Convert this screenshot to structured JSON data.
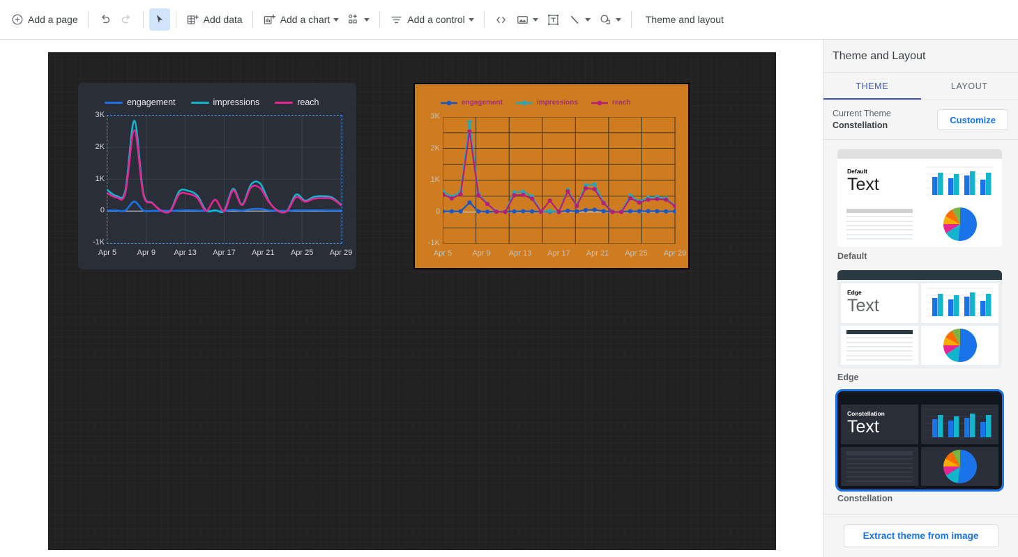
{
  "toolbar": {
    "add_page": "Add a page",
    "undo_icon": "undo-icon",
    "redo_icon": "redo-icon",
    "select_tool_icon": "cursor-arrow-icon",
    "add_data": "Add data",
    "add_chart": "Add a chart",
    "add_community_viz_icon": "community-visualization-icon",
    "add_control": "Add a control",
    "embed_icon": "embed-code-icon",
    "image_icon": "image-icon",
    "text_icon": "text-box-icon",
    "line_icon": "line-icon",
    "shape_icon": "shape-icon",
    "theme_and_layout": "Theme and layout"
  },
  "panel": {
    "title": "Theme and Layout",
    "tabs": [
      {
        "label": "THEME",
        "active": true
      },
      {
        "label": "LAYOUT",
        "active": false
      }
    ],
    "current_theme_label": "Current Theme",
    "current_theme_name": "Constellation",
    "customize_button": "Customize",
    "extract_theme_button": "Extract theme from image",
    "accent_color": "#1a73e8",
    "tab_active_color": "#4054b2",
    "themes": [
      {
        "name": "Default",
        "card_title": "Default",
        "card_text": "Text",
        "selected": false,
        "topbar": "#e0e0e0",
        "background": "#ffffff",
        "panel_bg": "#ffffff",
        "title_color": "#000000",
        "text_color": "#202124",
        "line_color": "#e8eaed",
        "line_head_color": "#d0d0d0"
      },
      {
        "name": "Edge",
        "card_title": "Edge",
        "card_text": "Text",
        "selected": false,
        "topbar": "#2b3a42",
        "background": "#eceff1",
        "panel_bg": "#ffffff",
        "title_color": "#000000",
        "text_color": "#5f6368",
        "line_color": "#e8eaed",
        "line_head_color": "#2b3a42"
      },
      {
        "name": "Constellation",
        "card_title": "Constellation",
        "card_text": "Text",
        "selected": true,
        "topbar": "#11161d",
        "background": "#11161d",
        "panel_bg": "#2a2e39",
        "title_color": "#ffffff",
        "text_color": "#ffffff",
        "line_color": "#343a46",
        "line_head_color": "#343a46"
      }
    ],
    "thumb_bar_colors": [
      "#1a73e8",
      "#12b5cb"
    ],
    "thumb_pie_colors": [
      "#1a73e8",
      "#12b5cb",
      "#e52592",
      "#f9ab00",
      "#ff6d01",
      "#7cb342"
    ]
  },
  "chart_data": [
    {
      "id": "chart1",
      "theme": "Constellation",
      "type": "line",
      "title": "",
      "xlabel": "",
      "ylabel": "",
      "smooth": true,
      "show_points": false,
      "selected": true,
      "background": "#2a2e39",
      "grid": true,
      "grid_color": "#3b4049",
      "legend_position": "top",
      "legend": [
        "engagement",
        "impressions",
        "reach"
      ],
      "ylim": [
        -1000,
        3000
      ],
      "yticks": [
        3000,
        2000,
        1000,
        0,
        -1000
      ],
      "ytick_labels": [
        "3K",
        "2K",
        "1K",
        "0",
        "-1K"
      ],
      "xticks": [
        "Apr 5",
        "Apr 9",
        "Apr 13",
        "Apr 17",
        "Apr 21",
        "Apr 25",
        "Apr 29"
      ],
      "x": [
        "Apr 4",
        "Apr 5",
        "Apr 6",
        "Apr 7",
        "Apr 8",
        "Apr 9",
        "Apr 10",
        "Apr 11",
        "Apr 12",
        "Apr 13",
        "Apr 14",
        "Apr 15",
        "Apr 16",
        "Apr 17",
        "Apr 18",
        "Apr 19",
        "Apr 20",
        "Apr 21",
        "Apr 22",
        "Apr 23",
        "Apr 24",
        "Apr 25",
        "Apr 26",
        "Apr 27",
        "Apr 28",
        "Apr 29",
        "Apr 30"
      ],
      "series": [
        {
          "name": "engagement",
          "color": "#1a73e8",
          "values": [
            20,
            20,
            20,
            300,
            20,
            10,
            10,
            10,
            20,
            25,
            20,
            10,
            10,
            10,
            40,
            20,
            60,
            70,
            25,
            10,
            10,
            25,
            25,
            30,
            25,
            20,
            20
          ]
        },
        {
          "name": "impressions",
          "color": "#12b5cb",
          "values": [
            660,
            480,
            640,
            2840,
            570,
            260,
            20,
            10,
            620,
            640,
            490,
            20,
            30,
            10,
            700,
            210,
            840,
            870,
            300,
            10,
            10,
            520,
            330,
            450,
            470,
            430,
            200
          ]
        },
        {
          "name": "reach",
          "color": "#e52592",
          "values": [
            560,
            430,
            560,
            2540,
            520,
            250,
            10,
            0,
            530,
            540,
            420,
            10,
            360,
            0,
            650,
            190,
            750,
            720,
            280,
            0,
            0,
            440,
            300,
            390,
            410,
            390,
            190
          ]
        }
      ]
    },
    {
      "id": "chart2",
      "theme": "Extracted (orange)",
      "type": "line",
      "title": "",
      "xlabel": "",
      "ylabel": "",
      "smooth": false,
      "show_points": true,
      "selected": false,
      "background": "#cf7c21",
      "grid": true,
      "grid_color": "#4a3a20",
      "legend_position": "top",
      "legend": [
        "engagement",
        "impressions",
        "reach"
      ],
      "legend_text_color": "#a0306e",
      "ylim": [
        -1000,
        3000
      ],
      "yticks": [
        3000,
        2000,
        1000,
        0,
        -1000
      ],
      "ytick_labels": [
        "3K",
        "2K",
        "1K",
        "0",
        "-1K"
      ],
      "xticks": [
        "Apr 5",
        "Apr 9",
        "Apr 13",
        "Apr 17",
        "Apr 21",
        "Apr 25",
        "Apr 29"
      ],
      "x": [
        "Apr 4",
        "Apr 5",
        "Apr 6",
        "Apr 7",
        "Apr 8",
        "Apr 9",
        "Apr 10",
        "Apr 11",
        "Apr 12",
        "Apr 13",
        "Apr 14",
        "Apr 15",
        "Apr 16",
        "Apr 17",
        "Apr 18",
        "Apr 19",
        "Apr 20",
        "Apr 21",
        "Apr 22",
        "Apr 23",
        "Apr 24",
        "Apr 25",
        "Apr 26",
        "Apr 27",
        "Apr 28",
        "Apr 29",
        "Apr 30"
      ],
      "series": [
        {
          "name": "engagement",
          "color": "#1a56c4",
          "values": [
            20,
            20,
            20,
            300,
            20,
            10,
            10,
            10,
            20,
            25,
            20,
            10,
            10,
            10,
            40,
            20,
            60,
            70,
            25,
            10,
            10,
            25,
            25,
            30,
            25,
            20,
            20
          ]
        },
        {
          "name": "impressions",
          "color": "#21a8bd",
          "values": [
            660,
            480,
            640,
            2840,
            570,
            260,
            20,
            10,
            620,
            640,
            490,
            20,
            30,
            10,
            700,
            210,
            840,
            870,
            300,
            10,
            10,
            520,
            330,
            450,
            470,
            430,
            200
          ]
        },
        {
          "name": "reach",
          "color": "#b51f78",
          "values": [
            560,
            430,
            560,
            2540,
            520,
            250,
            10,
            0,
            530,
            540,
            420,
            10,
            360,
            0,
            650,
            190,
            750,
            720,
            280,
            0,
            0,
            440,
            300,
            390,
            410,
            390,
            190
          ]
        }
      ]
    }
  ]
}
